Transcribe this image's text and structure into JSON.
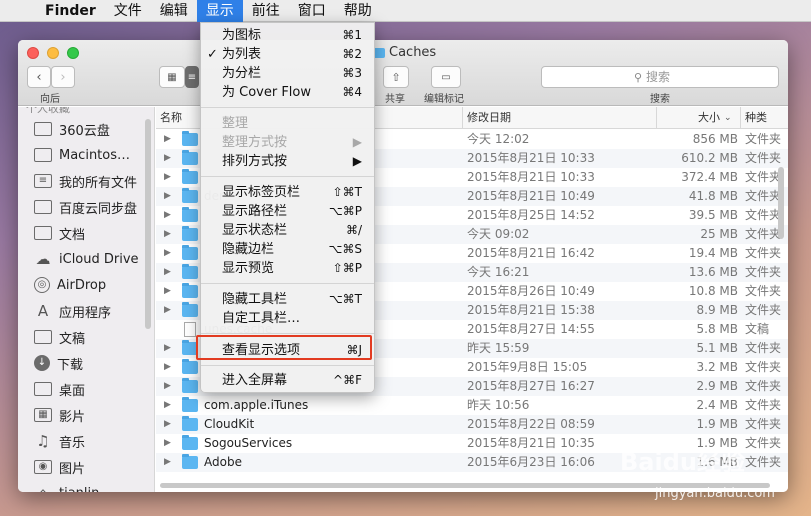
{
  "menubar": {
    "apple_glyph": "",
    "items": [
      "Finder",
      "文件",
      "编辑",
      "显示",
      "前往",
      "窗口",
      "帮助"
    ],
    "active": "显示"
  },
  "window": {
    "title": "Caches",
    "toolbar": {
      "back_label": "向后",
      "share_label": "共享",
      "edit_tags_label": "编辑标记",
      "search_label": "搜索",
      "search_placeholder": "搜索"
    }
  },
  "sidebar": {
    "section_header": "个人收藏",
    "items": [
      {
        "label": "360云盘",
        "icon": "folder-icon"
      },
      {
        "label": "Macintos…",
        "icon": "hard-drive-icon"
      },
      {
        "label": "我的所有文件",
        "icon": "all-files-icon"
      },
      {
        "label": "百度云同步盘",
        "icon": "folder-icon"
      },
      {
        "label": "文档",
        "icon": "folder-icon"
      },
      {
        "label": "iCloud Drive",
        "icon": "cloud-icon"
      },
      {
        "label": "AirDrop",
        "icon": "airdrop-icon"
      },
      {
        "label": "应用程序",
        "icon": "applications-icon"
      },
      {
        "label": "文稿",
        "icon": "documents-icon"
      },
      {
        "label": "下载",
        "icon": "download-icon"
      },
      {
        "label": "桌面",
        "icon": "desktop-icon"
      },
      {
        "label": "影片",
        "icon": "movies-icon"
      },
      {
        "label": "音乐",
        "icon": "music-icon"
      },
      {
        "label": "图片",
        "icon": "pictures-icon"
      },
      {
        "label": "tianlin",
        "icon": "home-icon"
      }
    ]
  },
  "list": {
    "columns": {
      "name": "名称",
      "date": "修改日期",
      "size": "大小",
      "kind": "种类"
    },
    "rows": [
      {
        "name": "",
        "date": "今天 12:02",
        "size": "856 MB",
        "kind": "文件夹",
        "type": "folder"
      },
      {
        "name": "",
        "date": "2015年8月21日 10:33",
        "size": "610.2 MB",
        "kind": "文件夹",
        "type": "folder"
      },
      {
        "name": "",
        "date": "2015年8月21日 10:33",
        "size": "372.4 MB",
        "kind": "文件夹",
        "type": "folder"
      },
      {
        "name": "der",
        "date": "2015年8月21日 10:49",
        "size": "41.8 MB",
        "kind": "文件夹",
        "type": "folder"
      },
      {
        "name": "",
        "date": "2015年8月25日 14:52",
        "size": "39.5 MB",
        "kind": "文件夹",
        "type": "folder"
      },
      {
        "name": "",
        "date": "今天 09:02",
        "size": "25 MB",
        "kind": "文件夹",
        "type": "folder"
      },
      {
        "name": "",
        "date": "2015年8月21日 16:42",
        "size": "19.4 MB",
        "kind": "文件夹",
        "type": "folder"
      },
      {
        "name": "",
        "date": "今天 16:21",
        "size": "13.6 MB",
        "kind": "文件夹",
        "type": "folder"
      },
      {
        "name": "",
        "date": "2015年8月26日 10:49",
        "size": "10.8 MB",
        "kind": "文件夹",
        "type": "folder"
      },
      {
        "name": "",
        "date": "2015年8月21日 15:38",
        "size": "8.9 MB",
        "kind": "文件夹",
        "type": "folder"
      },
      {
        "name": "unes.cache",
        "date": "2015年8月27日 14:55",
        "size": "5.8 MB",
        "kind": "文稿",
        "type": "doc"
      },
      {
        "name": "",
        "date": "昨天 15:59",
        "size": "5.1 MB",
        "kind": "文件夹",
        "type": "folder"
      },
      {
        "name": "",
        "date": "2015年9月8日 15:05",
        "size": "3.2 MB",
        "kind": "文件夹",
        "type": "folder"
      },
      {
        "name": "",
        "date": "2015年8月27日 16:27",
        "size": "2.9 MB",
        "kind": "文件夹",
        "type": "folder"
      },
      {
        "name": "com.apple.iTunes",
        "date": "昨天 10:56",
        "size": "2.4 MB",
        "kind": "文件夹",
        "type": "folder"
      },
      {
        "name": "CloudKit",
        "date": "2015年8月22日 08:59",
        "size": "1.9 MB",
        "kind": "文件夹",
        "type": "folder"
      },
      {
        "name": "SogouServices",
        "date": "2015年8月21日 10:35",
        "size": "1.9 MB",
        "kind": "文件夹",
        "type": "folder"
      },
      {
        "name": "Adobe",
        "date": "2015年6月23日 16:06",
        "size": "1.6 MB",
        "kind": "文件夹",
        "type": "folder"
      }
    ]
  },
  "view_menu": {
    "items": [
      {
        "label": "为图标",
        "shortcut": "⌘1"
      },
      {
        "label": "为列表",
        "shortcut": "⌘2",
        "checked": "✓"
      },
      {
        "label": "为分栏",
        "shortcut": "⌘3"
      },
      {
        "label": "为 Cover Flow",
        "shortcut": "⌘4"
      },
      {
        "label": "整理",
        "shortcut": ""
      },
      {
        "label": "整理方式按",
        "shortcut": "▶"
      },
      {
        "label": "排列方式按",
        "shortcut": "▶"
      },
      {
        "label": "显示标签页栏",
        "shortcut": "⇧⌘T"
      },
      {
        "label": "显示路径栏",
        "shortcut": "⌥⌘P"
      },
      {
        "label": "显示状态栏",
        "shortcut": "⌘/"
      },
      {
        "label": "隐藏边栏",
        "shortcut": "⌥⌘S"
      },
      {
        "label": "显示预览",
        "shortcut": "⇧⌘P"
      },
      {
        "label": "隐藏工具栏",
        "shortcut": "⌥⌘T"
      },
      {
        "label": "自定工具栏…",
        "shortcut": ""
      },
      {
        "label": "查看显示选项",
        "shortcut": "⌘J"
      },
      {
        "label": "进入全屏幕",
        "shortcut": "^⌘F"
      }
    ]
  },
  "watermark": {
    "brand": "Baidu经验",
    "url": "jingyan.baidu.com"
  },
  "colors": {
    "menu_highlight": "#2f80e8",
    "annotation_red": "#e23b21",
    "folder_blue": "#5bb6f1"
  }
}
